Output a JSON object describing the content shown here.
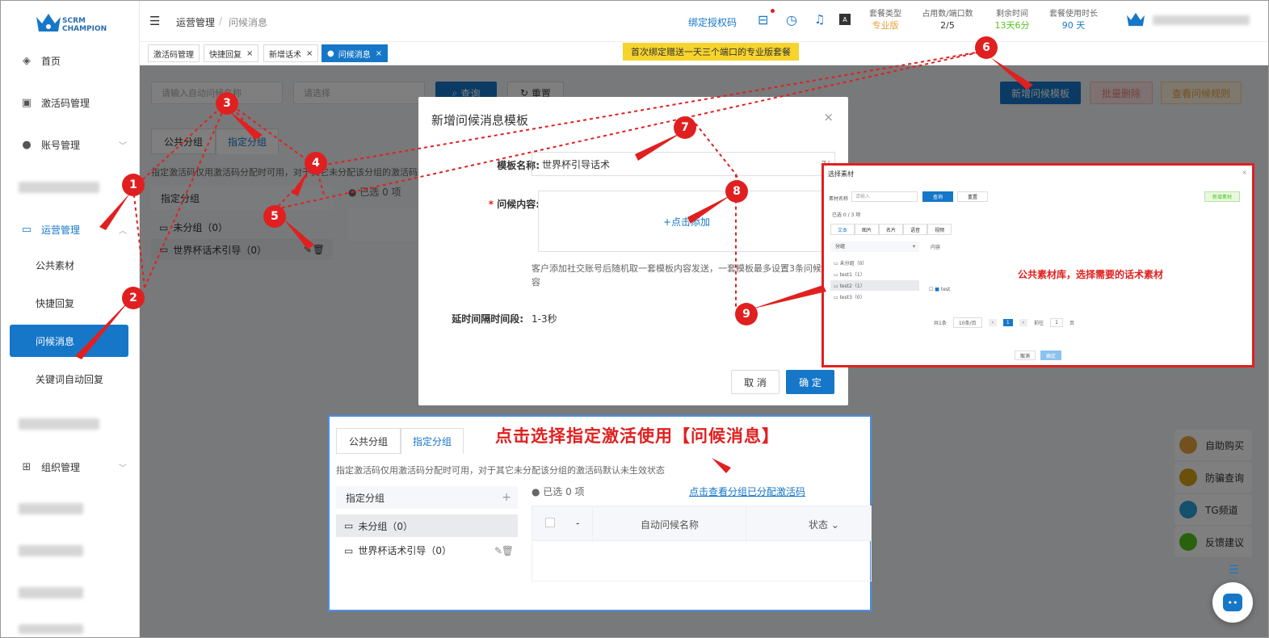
{
  "app": {
    "logo_line1": "SCRM",
    "logo_line2": "CHAMPION"
  },
  "sidebar": {
    "items": [
      {
        "label": "首页"
      },
      {
        "label": "激活码管理"
      },
      {
        "label": "账号管理"
      },
      {
        "label": "运营管理"
      },
      {
        "label": "组织管理"
      }
    ],
    "subitems": [
      {
        "label": "公共素材"
      },
      {
        "label": "快捷回复"
      },
      {
        "label": "问候消息"
      },
      {
        "label": "关键词自动回复"
      }
    ]
  },
  "header": {
    "breadcrumb_parent": "运营管理",
    "breadcrumb_sep": "/",
    "breadcrumb_current": "问候消息",
    "bind_code_link": "绑定授权码",
    "promo_banner": "首次绑定赠送一天三个端口的专业版套餐",
    "stats": [
      {
        "label": "套餐类型",
        "value": "专业版",
        "color": "#e6a23c"
      },
      {
        "label": "占用数/端口数",
        "value": "2/5",
        "color": "#333333"
      },
      {
        "label": "剩余时间",
        "value": "13天6分",
        "color": "#52c41a"
      },
      {
        "label": "套餐使用时长",
        "value": "90 天",
        "color": "#1677c8"
      }
    ]
  },
  "tabs": [
    {
      "label": "激活码管理"
    },
    {
      "label": "快捷回复"
    },
    {
      "label": "新增话术"
    },
    {
      "label": "问候消息"
    }
  ],
  "filters": {
    "name_placeholder": "请输入自动问候名称",
    "select_placeholder": "请选择",
    "query": "查询",
    "reset": "重置"
  },
  "actions": {
    "add": "新增问候模板",
    "batch_delete": "批量删除",
    "view_rules": "查看问候规则"
  },
  "group_tabs": {
    "public": "公共分组",
    "assigned": "指定分组"
  },
  "group_hint": "指定激活码仅用激活码分配时可用，对于其它未分配该分组的激活码默认未生效状态",
  "group_panel": {
    "title": "指定分组",
    "ungrouped": "未分组（0）",
    "worldcup": "世界杯话术引导（0）",
    "selected": "已选 0 项"
  },
  "modal": {
    "title": "新增问候消息模板",
    "name_label": "模板名称:",
    "name_value": "世界杯引导话术",
    "name_count": "7/",
    "content_label": "问候内容:",
    "add_link": "+点击添加",
    "note": "客户添加社交账号后随机取一套模板内容发送，一套模板最多设置3条问候内容",
    "delay_label": "延时间隔时间段:",
    "delay_value": "1-3秒",
    "cancel": "取 消",
    "confirm": "确 定"
  },
  "material": {
    "title": "选择素材",
    "name_label": "素材名称",
    "name_placeholder": "请输入",
    "query": "查询",
    "reset": "重置",
    "new": "新增素材",
    "selected": "已选 0 / 3 项",
    "tabs": [
      "文本",
      "图片",
      "名片",
      "语音",
      "视频"
    ],
    "group_header": "分组",
    "groups": [
      "未分组（0）",
      "test1（1）",
      "test2（1）",
      "test3（0）"
    ],
    "col_content": "内容",
    "item": "test",
    "annotation": "公共素材库，选择需要的话术素材",
    "total": "共1条",
    "per_page": "10条/页",
    "page": "1",
    "goto_label": "前往",
    "goto_value": "1",
    "page_unit": "页",
    "cancel": "取消",
    "confirm": "确定"
  },
  "inset": {
    "tab_public": "公共分组",
    "tab_assigned": "指定分组",
    "annotation": "点击选择指定激活使用【问候消息】",
    "hint": "指定激活码仅用激活码分配时可用，对于其它未分配该分组的激活码默认未生效状态",
    "panel_title": "指定分组",
    "selected": "已选 0 项",
    "view_link": "点击查看分组已分配激活码",
    "ungrouped": "未分组（0）",
    "worldcup": "世界杯话术引导（0）",
    "col_dash": "-",
    "col_name": "自动问候名称",
    "col_status": "状态"
  },
  "float": [
    {
      "label": "自助购买",
      "color": "#e6a23c"
    },
    {
      "label": "防骗查询",
      "color": "#d4a017"
    },
    {
      "label": "TG频道",
      "color": "#2aa1da"
    },
    {
      "label": "反馈建议",
      "color": "#52c41a"
    }
  ],
  "markers": [
    "1",
    "2",
    "3",
    "4",
    "5",
    "6",
    "7",
    "8",
    "9"
  ]
}
